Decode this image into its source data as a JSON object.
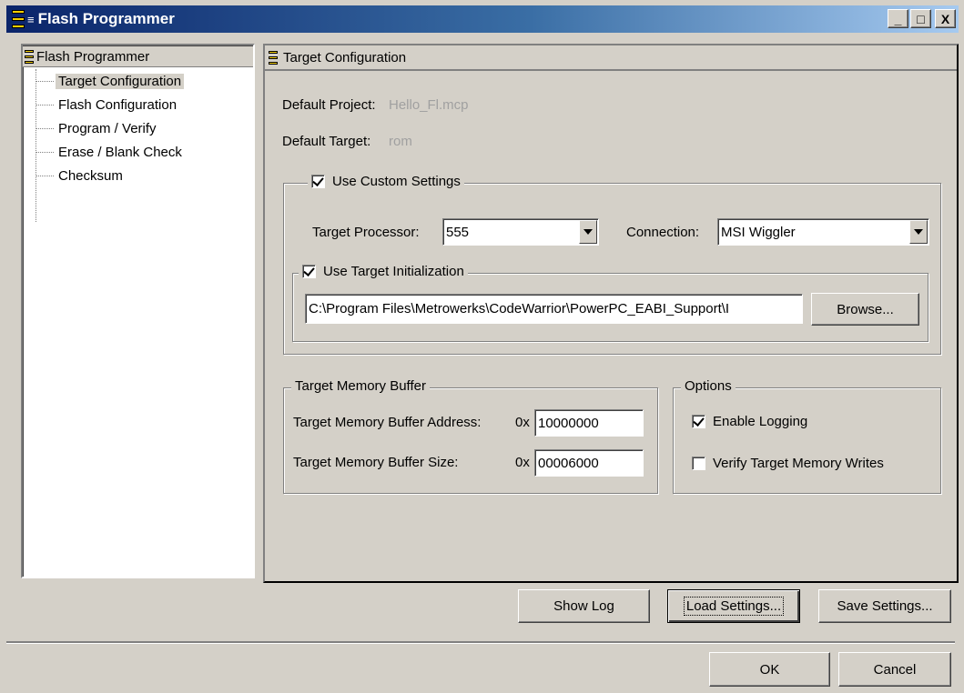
{
  "window": {
    "title": "Flash Programmer",
    "sysmenu_glyph": "≡",
    "minimize_glyph": "_",
    "maximize_glyph": "□",
    "close_glyph": "X"
  },
  "tree": {
    "root": "Flash Programmer",
    "items": [
      {
        "label": "Target Configuration"
      },
      {
        "label": "Flash Configuration"
      },
      {
        "label": "Program / Verify"
      },
      {
        "label": "Erase / Blank Check"
      },
      {
        "label": "Checksum"
      }
    ]
  },
  "panel": {
    "header": "Target Configuration",
    "default_project_label": "Default Project:",
    "default_project_value": "Hello_Fl.mcp",
    "default_target_label": "Default Target:",
    "default_target_value": "rom",
    "custom_settings": {
      "label": "Use Custom Settings",
      "checked": true,
      "processor_label": "Target Processor:",
      "processor_value": "555",
      "connection_label": "Connection:",
      "connection_value": "MSI Wiggler"
    },
    "target_init": {
      "label": "Use Target Initialization",
      "checked": true,
      "path_value": "C:\\Program Files\\Metrowerks\\CodeWarrior\\PowerPC_EABI_Support\\I",
      "browse_label": "Browse..."
    },
    "memory_buffer": {
      "legend": "Target Memory Buffer",
      "address_label": "Target Memory Buffer Address:",
      "address_prefix": "0x",
      "address_value": "10000000",
      "size_label": "Target Memory Buffer Size:",
      "size_prefix": "0x",
      "size_value": "00006000"
    },
    "options": {
      "legend": "Options",
      "enable_logging_label": "Enable Logging",
      "enable_logging_checked": true,
      "verify_writes_label": "Verify Target Memory Writes",
      "verify_writes_checked": false
    }
  },
  "buttons": {
    "show_log": "Show Log",
    "load_settings": "Load Settings...",
    "save_settings": "Save Settings...",
    "ok": "OK",
    "cancel": "Cancel"
  },
  "colors": {
    "titlebar_start": "#0a246a",
    "titlebar_end": "#a6caf0",
    "face": "#d4d0c8",
    "disabled_text": "#a0a0a0"
  }
}
